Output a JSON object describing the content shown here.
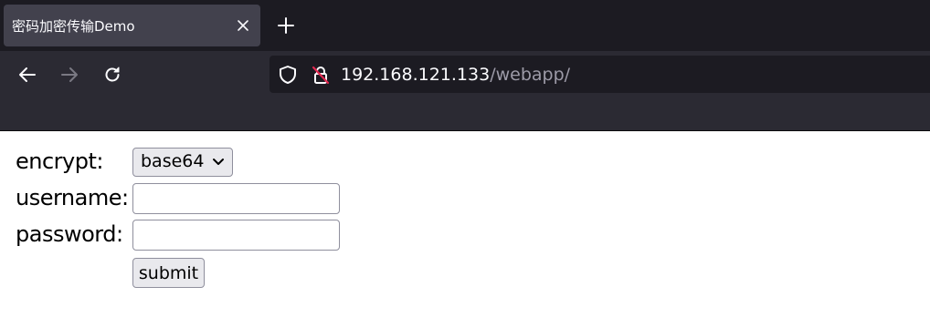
{
  "browser": {
    "tab_title": "密码加密传输Demo",
    "url_host": "192.168.121.133",
    "url_path": "/webapp/",
    "icons": {
      "tab_close": "close-icon",
      "new_tab": "plus-icon",
      "back": "arrow-left-icon",
      "forward": "arrow-right-icon",
      "reload": "reload-icon",
      "tracking_protection": "shield-icon",
      "insecure_connection": "insecure-lock-icon",
      "select_chevron": "chevron-down-icon"
    },
    "colors": {
      "tab_strip": "#1c1b22",
      "toolbar": "#2b2a33",
      "active_tab": "#42414d",
      "url_bar": "#1c1b22"
    }
  },
  "form": {
    "encrypt_label": "encrypt:",
    "encrypt_selected": "base64",
    "username_label": "username:",
    "username_value": "",
    "password_label": "password:",
    "password_value": "",
    "submit_label": "submit"
  }
}
